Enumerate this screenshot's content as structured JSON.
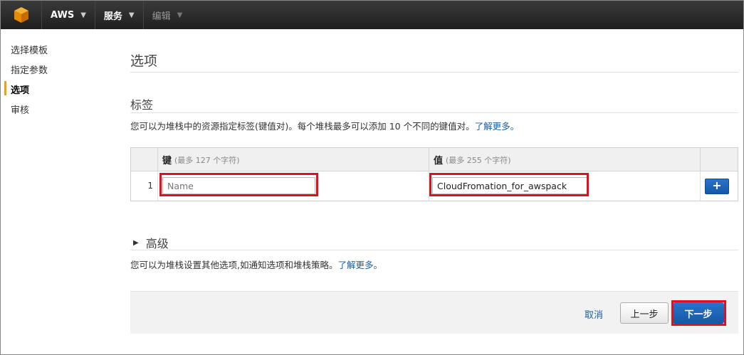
{
  "topbar": {
    "logo_icon": "aws-cube-icon",
    "aws_label": "AWS",
    "services_label": "服务",
    "edit_label": "编辑"
  },
  "sidebar": {
    "steps": [
      {
        "label": "选择模板",
        "active": false
      },
      {
        "label": "指定参数",
        "active": false
      },
      {
        "label": "选项",
        "active": true
      },
      {
        "label": "审核",
        "active": false
      }
    ]
  },
  "page": {
    "title": "选项",
    "tags": {
      "heading": "标签",
      "description": "您可以为堆栈中的资源指定标签(键值对)。每个堆栈最多可以添加 10 个不同的键值对。",
      "learn_more": "了解更多。",
      "key_header": "键",
      "key_hint": "(最多 127 个字符)",
      "value_header": "值",
      "value_hint": "(最多 255 个字符)",
      "rows": [
        {
          "index": "1",
          "key_placeholder": "Name",
          "value": "CloudFromation_for_awspack"
        }
      ],
      "add_label": "+"
    },
    "advanced": {
      "heading": "高级",
      "description": "您可以为堆栈设置其他选项,如通知选项和堆栈策略。",
      "learn_more": "了解更多。"
    },
    "footer": {
      "cancel_label": "取消",
      "prev_label": "上一步",
      "next_label": "下一步"
    }
  },
  "colors": {
    "accent": "#e8a317",
    "highlight": "#e01020",
    "primary": "#1458a8"
  }
}
